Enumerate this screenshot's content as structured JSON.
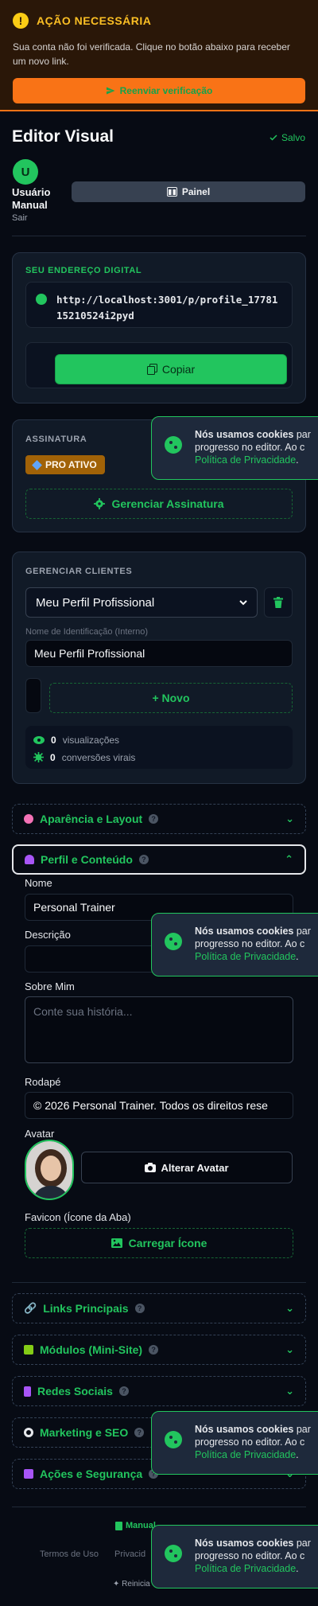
{
  "alert": {
    "icon": "warning-icon",
    "title": "AÇÃO NECESSÁRIA",
    "text": "Sua conta não foi verificada. Clique no botão abaixo para receber um novo link.",
    "button_label": "Reenviar verificação"
  },
  "header": {
    "title": "Editor Visual",
    "saved_label": "Salvo"
  },
  "user": {
    "initial": "U",
    "name": "Usuário Manual",
    "logout_label": "Sair",
    "panel_label": "Painel"
  },
  "address": {
    "label": "SEU ENDEREÇO DIGITAL",
    "url": "http://localhost:3001/p/profile_1778115210524i2pyd",
    "copy_label": "Copiar"
  },
  "subscription": {
    "label": "ASSINATURA",
    "badge": "PRO ATIVO",
    "manage_label": "Gerenciar Assinatura"
  },
  "clients": {
    "label": "GERENCIAR CLIENTES",
    "selected": "Meu Perfil Profissional",
    "id_label": "Nome de Identificação (Interno)",
    "id_value": "Meu Perfil Profissional",
    "new_label": "+ Novo",
    "views_count": "0",
    "views_label": "visualizações",
    "conversions_count": "0",
    "conversions_label": "conversões virais"
  },
  "sections": {
    "appearance": "Aparência e Layout",
    "profile": "Perfil e Conteúdo",
    "links": "Links Principais",
    "modules": "Módulos (Mini-Site)",
    "social": "Redes Sociais",
    "marketing": "Marketing e SEO",
    "actions": "Ações e Segurança"
  },
  "profile": {
    "name_label": "Nome",
    "name_value": "Personal Trainer",
    "description_label": "Descrição",
    "description_value": "",
    "about_label": "Sobre Mim",
    "about_placeholder": "Conte sua história...",
    "footer_label": "Rodapé",
    "footer_value": "© 2026 Personal Trainer. Todos os direitos rese",
    "avatar_label": "Avatar",
    "change_avatar_label": "Alterar Avatar",
    "favicon_label": "Favicon (Ícone da Aba)",
    "upload_icon_label": "Carregar Ícone"
  },
  "footer": {
    "manual_label": "Manual",
    "terms_label": "Termos de Uso",
    "privacy_label": "Privacid",
    "restart_label": "Reinicia"
  },
  "cookie": {
    "bold": "Nós usamos cookies",
    "line1_rest": " par",
    "line2": "progresso no editor. Ao c",
    "link": "Política de Privacidade",
    "end": "."
  },
  "colors": {
    "accent": "#22c55e",
    "warning": "#f97316",
    "background": "#070b14"
  }
}
